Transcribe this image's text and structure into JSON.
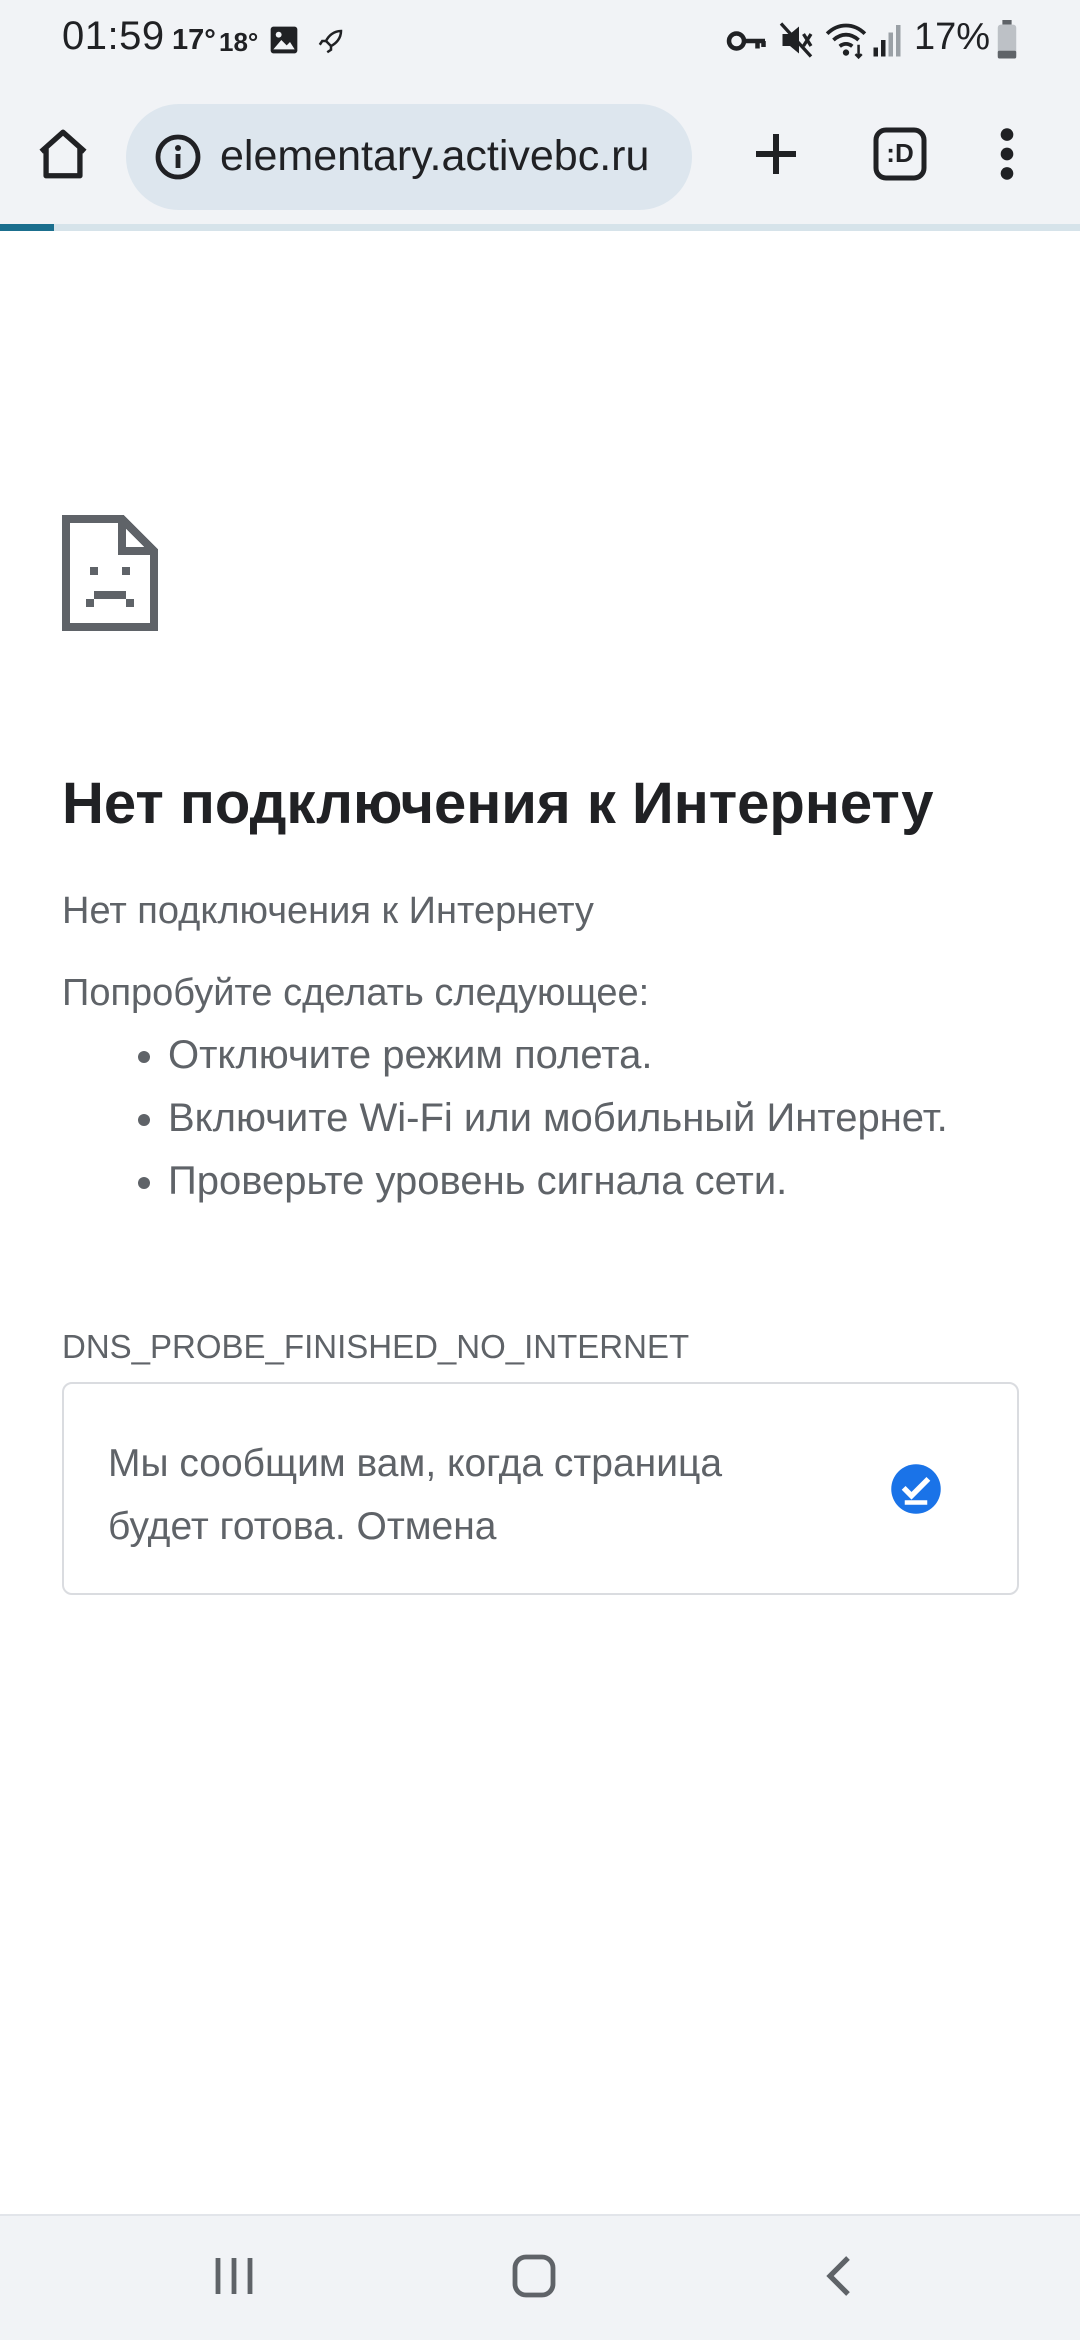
{
  "status_bar": {
    "time": "01:59",
    "temp_1": "17°",
    "temp_2": "18°",
    "icons": [
      "image-icon",
      "rocket-icon",
      "vpn-key-icon",
      "mute-icon",
      "wifi-icon",
      "signal-icon",
      "battery-icon"
    ],
    "battery": "17%"
  },
  "toolbar": {
    "url": "elementary.activebc.ru",
    "icons": [
      "home-icon",
      "info-icon",
      "new-tab-icon",
      "tab-switcher-icon",
      "more-menu-icon"
    ],
    "tab_switcher_label": ":D",
    "load_progress": 0.05
  },
  "page": {
    "title": "Нет подключения к Интернету",
    "subtitle": "Нет подключения к Интернету",
    "try_label": "Попробуйте сделать следующее:",
    "suggestions": [
      "Отключите режим полета.",
      "Включите Wi-Fi или мобильный Интернет.",
      "Проверьте уровень сигнала сети."
    ],
    "error_code": "DNS_PROBE_FINISHED_NO_INTERNET",
    "notify": {
      "text": "Мы сообщим вам, когда страница будет готова. Отмена",
      "icon": "check-circle-icon"
    }
  },
  "colors": {
    "accent": "#1a73e8",
    "progress": "#1b6f8e",
    "omnibox": "#dde6ee",
    "chrome_bg": "#f1f3f6"
  },
  "nav_bar": {
    "icons": [
      "recents-icon",
      "home-nav-icon",
      "back-icon"
    ]
  }
}
